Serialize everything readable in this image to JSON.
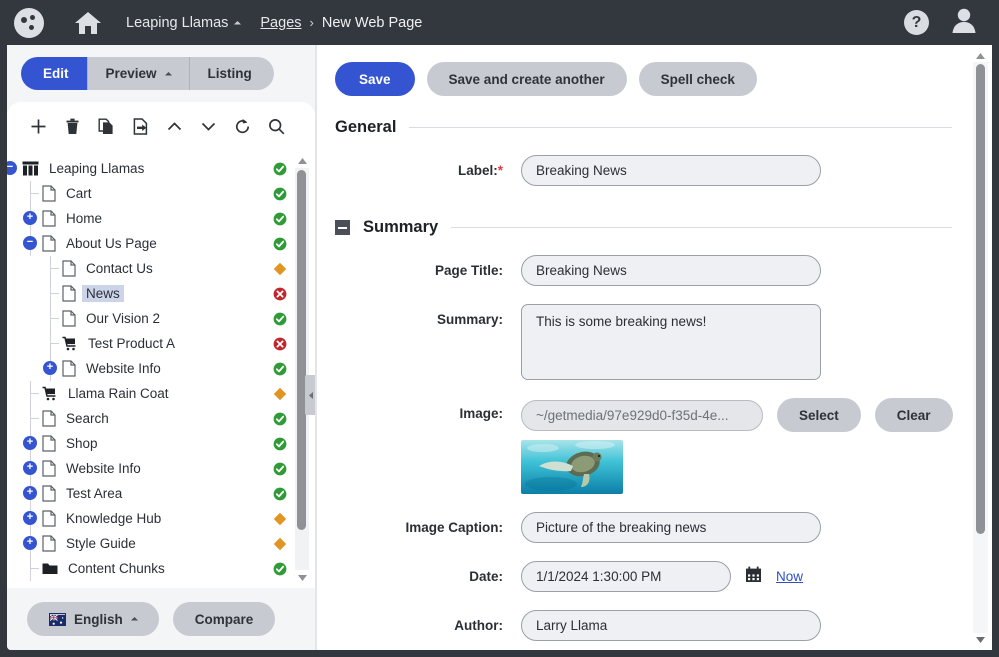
{
  "header": {
    "logo_icon": "llama-dots-logo",
    "home_icon": "home-icon",
    "site_name": "Leaping Llamas",
    "site_caret_icon": "chevron-down-icon",
    "breadcrumb_parent": "Pages",
    "breadcrumb_separator": "›",
    "breadcrumb_current": "New Web Page",
    "help_icon": "help-icon",
    "help_glyph": "?",
    "avatar_icon": "user-avatar-icon",
    "bg_color": "#33373e"
  },
  "sidebar": {
    "tabs": [
      {
        "label": "Edit",
        "active": true,
        "has_caret": false
      },
      {
        "label": "Preview",
        "active": false,
        "has_caret": true
      },
      {
        "label": "Listing",
        "active": false,
        "has_caret": false
      }
    ],
    "toolbar": [
      {
        "name": "new-page-button",
        "icon": "plus-icon"
      },
      {
        "name": "delete-page-button",
        "icon": "trash-icon"
      },
      {
        "name": "copy-page-button",
        "icon": "copy-icon"
      },
      {
        "name": "move-page-button",
        "icon": "move-document-icon"
      },
      {
        "name": "move-up-button",
        "icon": "chevron-up-icon"
      },
      {
        "name": "move-down-button",
        "icon": "chevron-down-icon"
      },
      {
        "name": "refresh-button",
        "icon": "refresh-icon"
      },
      {
        "name": "search-button",
        "icon": "search-icon"
      }
    ],
    "tree": [
      {
        "label": "Leaping Llamas",
        "level": 0,
        "toggle": "minus",
        "icon": "site-icon",
        "status": "published",
        "selected": false
      },
      {
        "label": "Cart",
        "level": 1,
        "toggle": "none",
        "icon": "page-icon",
        "status": "published",
        "selected": false
      },
      {
        "label": "Home",
        "level": 1,
        "toggle": "plus",
        "icon": "page-icon",
        "status": "published",
        "selected": false
      },
      {
        "label": "About Us Page",
        "level": 1,
        "toggle": "minus",
        "icon": "page-icon",
        "status": "published",
        "selected": false
      },
      {
        "label": "Contact Us",
        "level": 2,
        "toggle": "none",
        "icon": "page-icon",
        "status": "modified",
        "selected": false
      },
      {
        "label": "News",
        "level": 2,
        "toggle": "none",
        "icon": "page-icon",
        "status": "unpublished",
        "selected": true
      },
      {
        "label": "Our Vision 2",
        "level": 2,
        "toggle": "none",
        "icon": "page-icon",
        "status": "published",
        "selected": false
      },
      {
        "label": "Test Product A",
        "level": 2,
        "toggle": "none",
        "icon": "product-icon",
        "status": "unpublished",
        "selected": false
      },
      {
        "label": "Website Info",
        "level": 2,
        "toggle": "plus",
        "icon": "page-icon",
        "status": "published",
        "selected": false
      },
      {
        "label": "Llama Rain Coat",
        "level": 1,
        "toggle": "none",
        "icon": "product-icon",
        "status": "modified",
        "selected": false
      },
      {
        "label": "Search",
        "level": 1,
        "toggle": "none",
        "icon": "page-icon",
        "status": "published",
        "selected": false
      },
      {
        "label": "Shop",
        "level": 1,
        "toggle": "plus",
        "icon": "page-icon",
        "status": "published",
        "selected": false
      },
      {
        "label": "Website Info",
        "level": 1,
        "toggle": "plus",
        "icon": "page-icon",
        "status": "published",
        "selected": false
      },
      {
        "label": "Test Area",
        "level": 1,
        "toggle": "plus",
        "icon": "page-icon",
        "status": "published",
        "selected": false
      },
      {
        "label": "Knowledge Hub",
        "level": 1,
        "toggle": "plus",
        "icon": "page-icon",
        "status": "modified",
        "selected": false
      },
      {
        "label": "Style Guide",
        "level": 1,
        "toggle": "plus",
        "icon": "page-icon",
        "status": "modified",
        "selected": false
      },
      {
        "label": "Content Chunks",
        "level": 1,
        "toggle": "none",
        "icon": "folder-icon",
        "status": "published",
        "selected": false
      }
    ],
    "status_colors": {
      "published": "#2e9b36",
      "modified": "#e09521",
      "unpublished": "#c0272d"
    },
    "scrollbar": {
      "up_icon": "scroll-up-arrow",
      "down_icon": "scroll-down-arrow"
    },
    "panel_handle_icon": "collapse-panel-icon",
    "footer": {
      "language_label": "English",
      "language_flag": "australia-flag-icon",
      "language_caret_icon": "chevron-down-icon",
      "compare_label": "Compare"
    }
  },
  "main": {
    "toolbar": {
      "save_label": "Save",
      "save_create_label": "Save and create another",
      "spell_check_label": "Spell check"
    },
    "sections": [
      {
        "title": "General",
        "collapsible": false
      },
      {
        "title": "Summary",
        "collapsible": true
      }
    ],
    "fields": {
      "label": {
        "label": "Label:",
        "required": true,
        "value": "Breaking News"
      },
      "page_title": {
        "label": "Page Title:",
        "value": "Breaking News"
      },
      "summary": {
        "label": "Summary:",
        "value": "This is some breaking news!"
      },
      "image": {
        "label": "Image:",
        "value": "~/getmedia/97e929d0-f35d-4e...",
        "select_label": "Select",
        "clear_label": "Clear",
        "thumbnail_alt": "sea-turtle-thumbnail"
      },
      "image_caption": {
        "label": "Image Caption:",
        "value": "Picture of the breaking news"
      },
      "date": {
        "label": "Date:",
        "value": "1/1/2024 1:30:00 PM",
        "calendar_icon": "calendar-icon",
        "now_link": "Now"
      },
      "author": {
        "label": "Author:",
        "value": "Larry Llama"
      }
    },
    "scrollbar": {
      "up_icon": "scroll-up-arrow",
      "down_icon": "scroll-down-arrow"
    }
  },
  "theme": {
    "accent": "#3454d1",
    "header_bg": "#33373e",
    "button_bg": "#c7cad1",
    "required_color": "#e03a3a"
  }
}
